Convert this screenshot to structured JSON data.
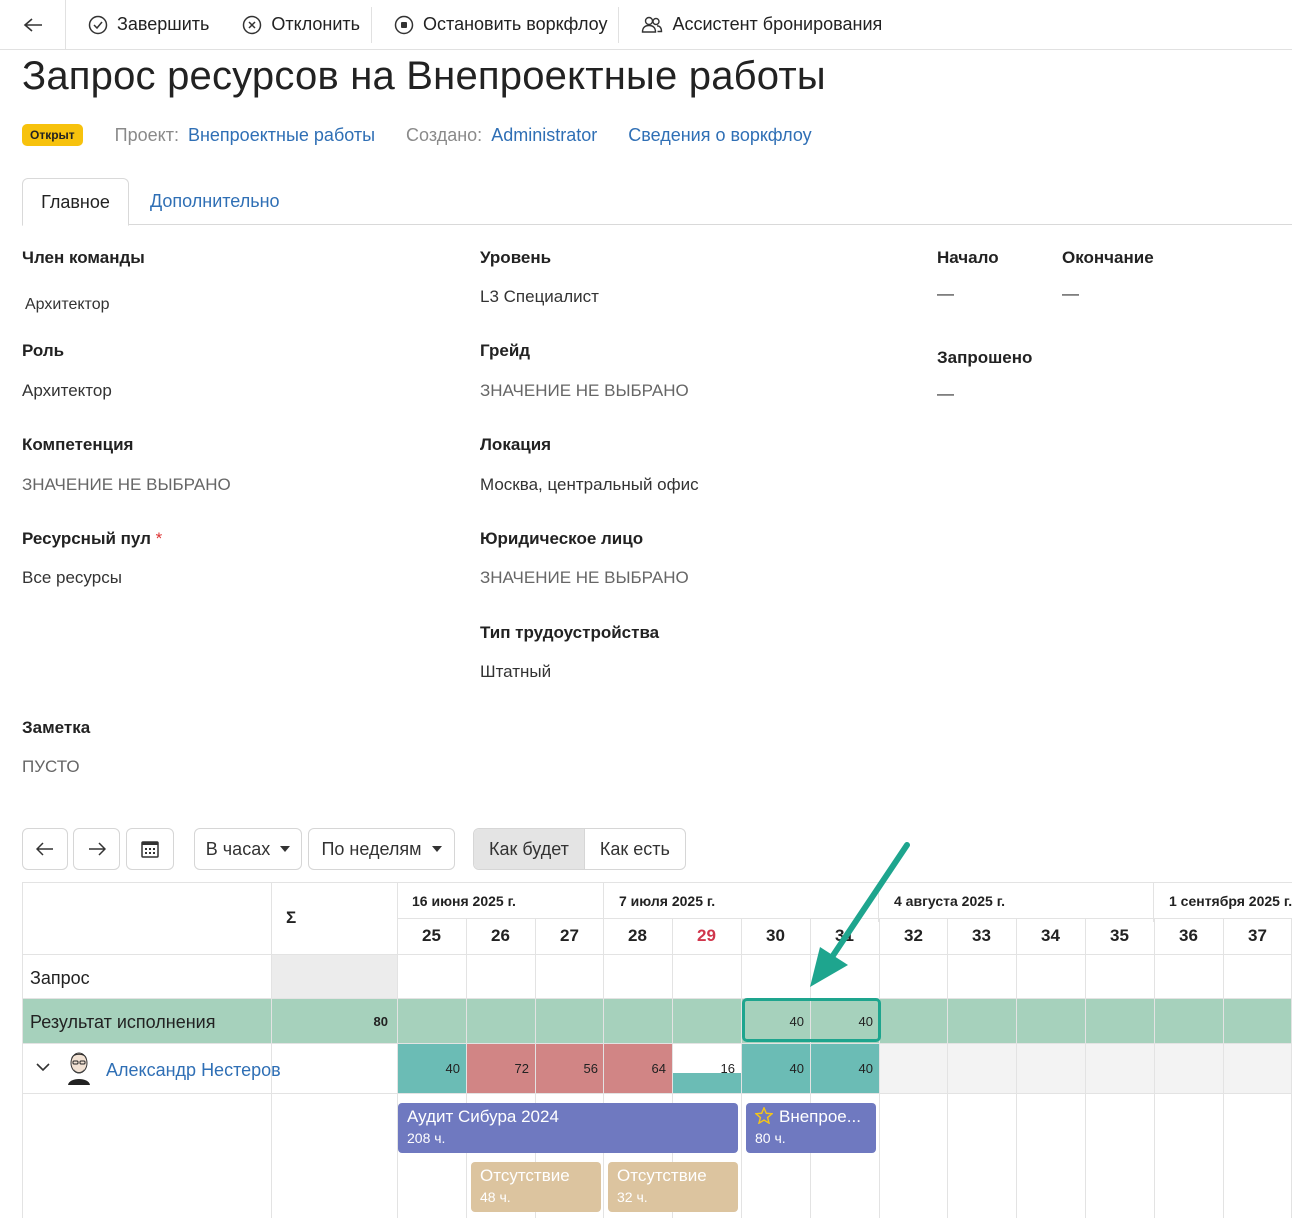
{
  "toolbar": {
    "complete": "Завершить",
    "reject": "Отклонить",
    "stop_workflow": "Остановить воркфлоу",
    "booking_assistant": "Ассистент бронирования"
  },
  "page": {
    "title": "Запрос ресурсов на Внепроектные работы",
    "status": "Открыт",
    "project_label": "Проект:",
    "project_value": "Внепроектные работы",
    "created_label": "Создано:",
    "created_value": "Administrator",
    "workflow_link": "Сведения о воркфлоу"
  },
  "tabs": {
    "main": "Главное",
    "extra": "Дополнительно"
  },
  "fields": {
    "team_member": {
      "label": "Член команды",
      "value": "Архитектор"
    },
    "role": {
      "label": "Роль",
      "value": "Архитектор"
    },
    "competence": {
      "label": "Компетенция",
      "value": "ЗНАЧЕНИЕ НЕ ВЫБРАНО"
    },
    "resource_pool": {
      "label": "Ресурсный пул",
      "required": "*",
      "value": "Все ресурсы"
    },
    "level": {
      "label": "Уровень",
      "value": "L3 Специалист"
    },
    "grade": {
      "label": "Грейд",
      "value": "ЗНАЧЕНИЕ НЕ ВЫБРАНО"
    },
    "location": {
      "label": "Локация",
      "value": "Москва, центральный офис"
    },
    "legal_entity": {
      "label": "Юридическое лицо",
      "value": "ЗНАЧЕНИЕ НЕ ВЫБРАНО"
    },
    "employment_type": {
      "label": "Тип трудоустройства",
      "value": "Штатный"
    },
    "start": {
      "label": "Начало",
      "value": "—"
    },
    "end": {
      "label": "Окончание",
      "value": "—"
    },
    "requested": {
      "label": "Запрошено",
      "value": "—"
    },
    "note": {
      "label": "Заметка",
      "value": "ПУСТО"
    }
  },
  "planner": {
    "units": "В часах",
    "period": "По неделям",
    "mode_to_be": "Как будет",
    "mode_as_is": "Как есть",
    "sigma": "Σ",
    "months": [
      "16 июня 2025 г.",
      "7 июля 2025 г.",
      "4 августа 2025 г.",
      "1 сентября 2025 г."
    ],
    "weeks": [
      "25",
      "26",
      "27",
      "28",
      "29",
      "30",
      "31",
      "32",
      "33",
      "34",
      "35",
      "36",
      "37"
    ],
    "highlight_week": "29",
    "rows": {
      "request": "Запрос",
      "result": "Результат исполнения",
      "result_total": "80",
      "result_values": [
        "",
        "",
        "",
        "",
        "",
        "40",
        "40",
        "",
        "",
        "",
        "",
        "",
        ""
      ],
      "person": "Александр Нестеров",
      "person_values": [
        "40",
        "72",
        "56",
        "64",
        "16",
        "40",
        "40",
        "",
        "",
        "",
        "",
        "",
        ""
      ]
    },
    "bars": [
      {
        "title": "Аудит Сибура 2024",
        "hours": "208 ч."
      },
      {
        "title": "Внепрое...",
        "hours": "80 ч."
      },
      {
        "title": "Отсутствие",
        "hours": "48 ч."
      },
      {
        "title": "Отсутствие",
        "hours": "32 ч."
      }
    ],
    "colors": {
      "result_band": "#a6d1bc",
      "teal": "#6bbcb5",
      "overload": "#d18585",
      "project_bar": "#6f79c0",
      "absence_bar": "#dcc49f",
      "highlight": "#1ea58e"
    }
  }
}
